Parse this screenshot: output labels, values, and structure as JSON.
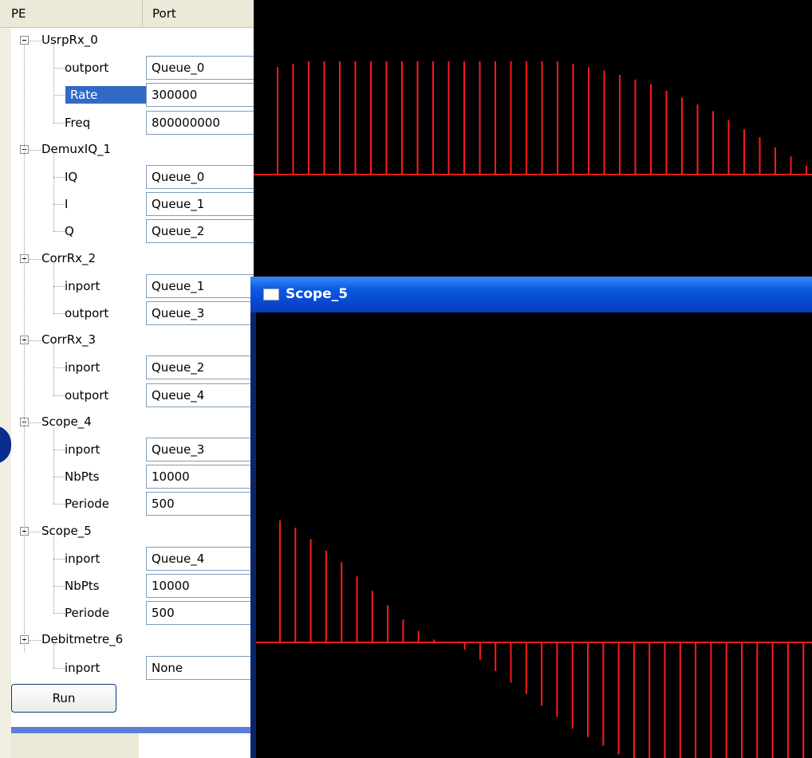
{
  "tree_panel": {
    "columns": {
      "pe": "PE",
      "port": "Port"
    },
    "nodes": [
      {
        "pe": "UsrpRx_0",
        "ports": [
          {
            "name": "outport",
            "value": "Queue_0"
          },
          {
            "name": "Rate",
            "value": "300000",
            "selected": true
          },
          {
            "name": "Freq",
            "value": "800000000"
          }
        ]
      },
      {
        "pe": "DemuxIQ_1",
        "ports": [
          {
            "name": "IQ",
            "value": "Queue_0"
          },
          {
            "name": "I",
            "value": "Queue_1"
          },
          {
            "name": "Q",
            "value": "Queue_2"
          }
        ]
      },
      {
        "pe": "CorrRx_2",
        "ports": [
          {
            "name": "inport",
            "value": "Queue_1"
          },
          {
            "name": "outport",
            "value": "Queue_3"
          }
        ]
      },
      {
        "pe": "CorrRx_3",
        "ports": [
          {
            "name": "inport",
            "value": "Queue_2"
          },
          {
            "name": "outport",
            "value": "Queue_4"
          }
        ]
      },
      {
        "pe": "Scope_4",
        "ports": [
          {
            "name": "inport",
            "value": "Queue_3"
          },
          {
            "name": "NbPts",
            "value": "10000"
          },
          {
            "name": "Periode",
            "value": "500"
          }
        ]
      },
      {
        "pe": "Scope_5",
        "ports": [
          {
            "name": "inport",
            "value": "Queue_4"
          },
          {
            "name": "NbPts",
            "value": "10000"
          },
          {
            "name": "Periode",
            "value": "500"
          }
        ]
      },
      {
        "pe": "Debitmetre_6",
        "ports": [
          {
            "name": "inport",
            "value": "None"
          }
        ]
      }
    ],
    "run_button": "Run"
  },
  "scope4_window": {
    "trace_color": "#ff1a1a",
    "spike_heights": [
      0.95,
      0.98,
      1.0,
      1.0,
      1.0,
      1.0,
      1.0,
      1.0,
      1.0,
      1.0,
      1.0,
      1.0,
      1.0,
      1.0,
      1.0,
      1.0,
      1.0,
      1.0,
      1.0,
      0.98,
      0.95,
      0.92,
      0.88,
      0.84,
      0.8,
      0.74,
      0.68,
      0.62,
      0.56,
      0.48,
      0.4,
      0.33,
      0.24,
      0.16,
      0.08
    ]
  },
  "scope5_window": {
    "title": "Scope_5",
    "trace_color": "#ff1a1a",
    "spike_heights": [
      0.85,
      0.8,
      0.72,
      0.64,
      0.56,
      0.46,
      0.36,
      0.26,
      0.16,
      0.08,
      0.02,
      0,
      -0.05,
      -0.12,
      -0.2,
      -0.28,
      -0.36,
      -0.44,
      -0.52,
      -0.6,
      -0.66,
      -0.72,
      -0.78,
      -0.84,
      -0.88,
      -0.92,
      -0.95,
      -0.97,
      -0.99,
      -1.0,
      -1.0,
      -1.0,
      -1.0,
      -1.0,
      -1.0
    ]
  }
}
